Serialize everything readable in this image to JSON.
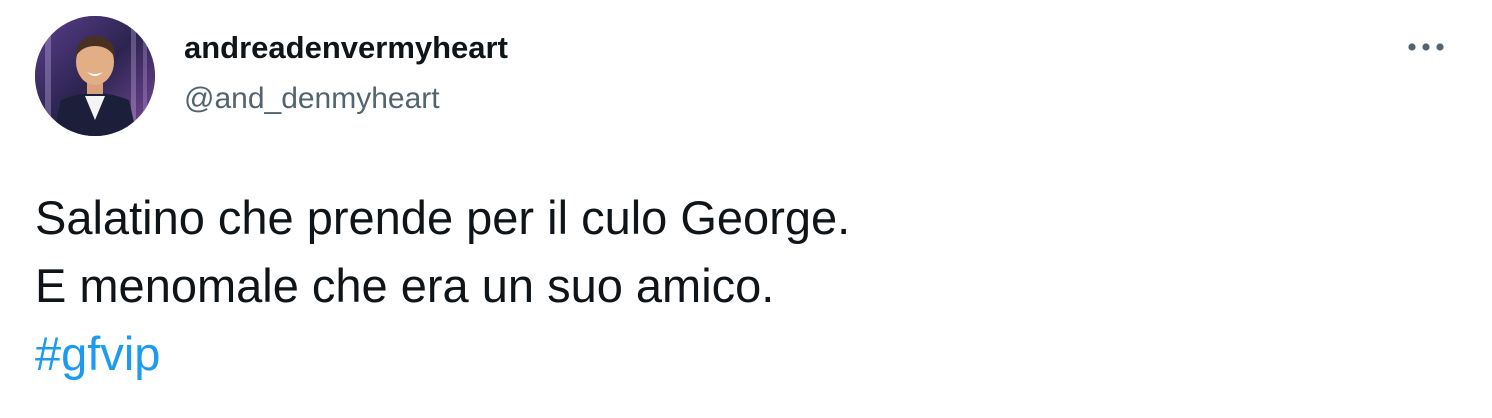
{
  "user": {
    "display_name": "andreadenvermyheart",
    "handle": "@and_denmyheart"
  },
  "menu": {
    "icon": "more-horizontal-icon"
  },
  "tweet": {
    "lines": [
      "Salatino che prende per il culo George.",
      "E menomale che era un suo amico."
    ],
    "hashtag": "#gfvip"
  },
  "colors": {
    "text": "#0f1419",
    "secondary": "#536471",
    "link": "#1d9bf0",
    "background": "#ffffff"
  }
}
